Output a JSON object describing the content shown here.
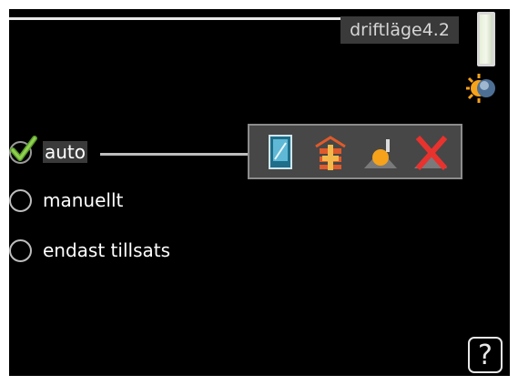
{
  "header": {
    "title": "driftläge4.2"
  },
  "options": [
    {
      "label": "auto",
      "selected": true
    },
    {
      "label": "manuellt",
      "selected": false
    },
    {
      "label": "endast tillsats",
      "selected": false
    }
  ],
  "mode_icons": [
    "cooling-icon",
    "addition-heat-icon",
    "heating-icon",
    "disabled-icon"
  ],
  "help": {
    "label": "?"
  },
  "colors": {
    "background": "#000000",
    "text": "#ffffff",
    "check": "#7bc043",
    "cross": "#e8322e"
  }
}
